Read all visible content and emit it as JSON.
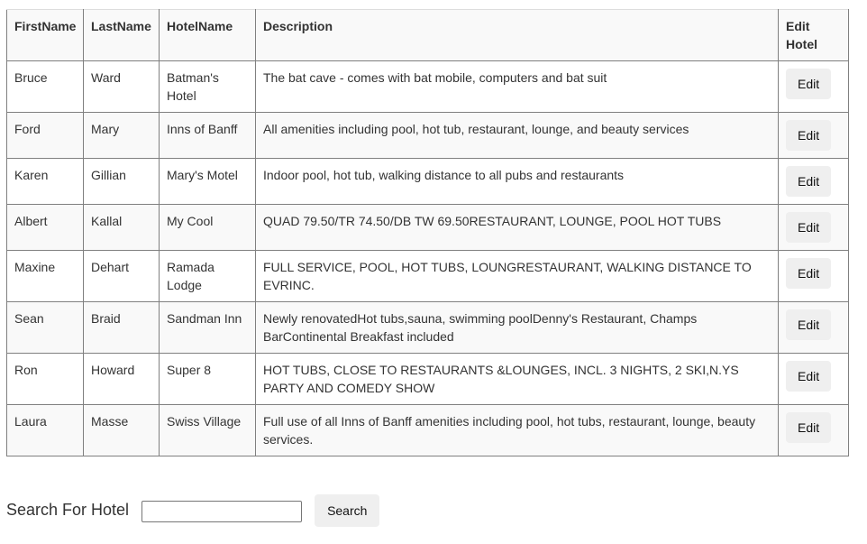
{
  "table": {
    "headers": {
      "first_name": "FirstName",
      "last_name": "LastName",
      "hotel_name": "HotelName",
      "description": "Description",
      "edit_hotel": "Edit Hotel"
    },
    "rows": [
      {
        "first_name": "Bruce",
        "last_name": "Ward",
        "hotel_name": "Batman's Hotel",
        "description": "The bat cave - comes with bat mobile, computers and bat suit",
        "edit_label": "Edit"
      },
      {
        "first_name": "Ford",
        "last_name": "Mary",
        "hotel_name": "Inns of Banff",
        "description": "All amenities including pool, hot tub, restaurant, lounge, and beauty services",
        "edit_label": "Edit"
      },
      {
        "first_name": "Karen",
        "last_name": "Gillian",
        "hotel_name": "Mary's Motel",
        "description": "Indoor pool, hot tub, walking distance to all pubs and restaurants",
        "edit_label": "Edit"
      },
      {
        "first_name": "Albert",
        "last_name": "Kallal",
        "hotel_name": "My Cool",
        "description": "QUAD 79.50/TR 74.50/DB TW 69.50RESTAURANT, LOUNGE, POOL HOT TUBS",
        "edit_label": "Edit"
      },
      {
        "first_name": "Maxine",
        "last_name": "Dehart",
        "hotel_name": "Ramada Lodge",
        "description": "FULL SERVICE, POOL, HOT TUBS, LOUNGRESTAURANT, WALKING DISTANCE TO EVRINC.",
        "edit_label": "Edit"
      },
      {
        "first_name": "Sean",
        "last_name": "Braid",
        "hotel_name": "Sandman Inn",
        "description": "Newly renovatedHot tubs,sauna, swimming poolDenny's Restaurant, Champs BarContinental Breakfast included",
        "edit_label": "Edit"
      },
      {
        "first_name": "Ron",
        "last_name": "Howard",
        "hotel_name": "Super 8",
        "description": "HOT TUBS, CLOSE TO RESTAURANTS &LOUNGES, INCL. 3 NIGHTS, 2 SKI,N.YS PARTY AND COMEDY SHOW",
        "edit_label": "Edit"
      },
      {
        "first_name": "Laura",
        "last_name": "Masse",
        "hotel_name": "Swiss Village",
        "description": "Full use of all Inns of Banff amenities including pool, hot tubs, restaurant, lounge, beauty services.",
        "edit_label": "Edit"
      }
    ]
  },
  "search": {
    "label": "Search For Hotel",
    "input_value": "",
    "input_placeholder": "",
    "button_label": "Search"
  }
}
